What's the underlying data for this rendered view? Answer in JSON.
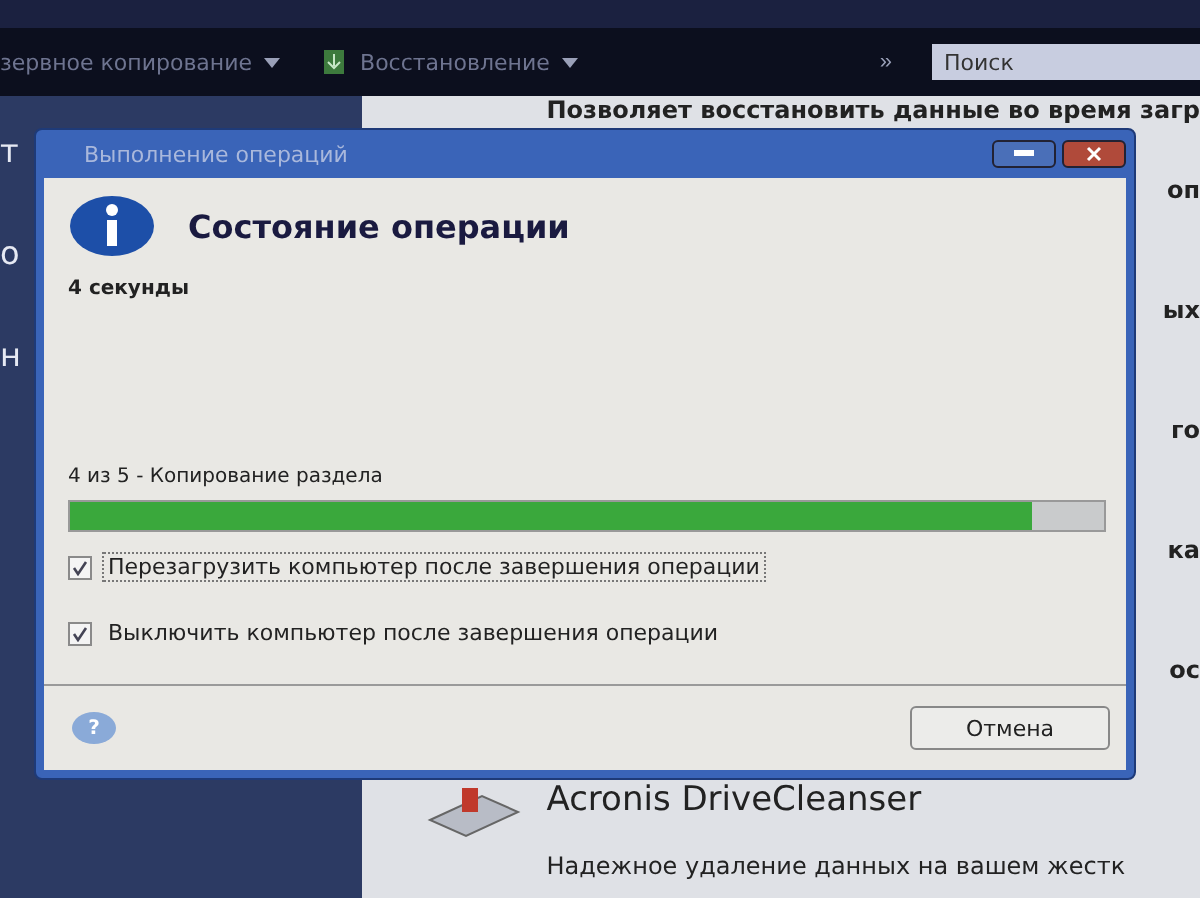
{
  "toolbar": {
    "items": [
      {
        "label": "зервное копирование"
      },
      {
        "label": "Восстановление"
      }
    ],
    "more": "»",
    "search": {
      "placeholder": "Поиск"
    }
  },
  "sidebar_fragments": [
    "т",
    "о",
    "н"
  ],
  "content": {
    "header": "Позволяет восстановить данные во время загр",
    "right_fragments": [
      "оп",
      "ых",
      "го",
      "ка",
      "ос"
    ],
    "tool": {
      "name": "Acronis DriveCleanser",
      "description": "Надежное удаление данных на вашем жестк"
    }
  },
  "dialog": {
    "title": "Выполнение операций",
    "heading": "Состояние операции",
    "elapsed": "4 секунды",
    "step": "4 из 5 - Копирование раздела",
    "progress": {
      "level": 0.93
    },
    "options": [
      {
        "label": "Перезагрузить компьютер после завершения операции",
        "checked": true,
        "focused": true
      },
      {
        "label": "Выключить компьютер после завершения операции",
        "checked": true,
        "focused": false
      }
    ],
    "help": "?",
    "cancel": "Отмена"
  }
}
